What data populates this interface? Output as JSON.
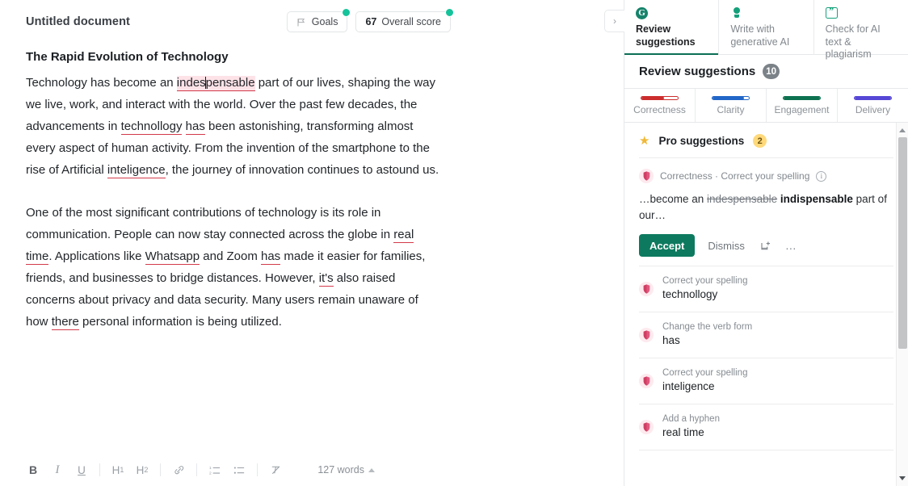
{
  "document": {
    "title": "Untitled document",
    "goals_label": "Goals",
    "score_value": "67",
    "score_label": "Overall score",
    "heading": "The Rapid Evolution of Technology",
    "paragraph1": {
      "seg1": "Technology has become an ",
      "error1": "indes",
      "error1b": "pensable",
      "seg2": " part of our lives, shaping the way we live, work, and interact with the world. Over the past few decades, the advancements in ",
      "error2": "technollogy",
      "seg3": " ",
      "error3": "has",
      "seg4": " been astonishing, transforming almost every aspect of human activity. From the invention of the smartphone to the rise of Artificial ",
      "error4": "inteligence",
      "seg5": ", the journey of innovation continues to astound us."
    },
    "paragraph2": {
      "seg1": "One of the most significant contributions of technology is its role in communication. People can now stay connected across the globe in ",
      "error1": "real time",
      "seg2": ". Applications like ",
      "error2": "Whatsapp",
      "seg3": " and Zoom ",
      "error3": "has",
      "seg4": " made it easier for families, friends, and businesses to bridge distances. However, ",
      "error4": "it's",
      "seg5": " also raised concerns about privacy and data security. Many users remain unaware of how ",
      "error5": "there",
      "seg6": " personal information is being utilized."
    },
    "toolbar": {
      "bold": "B",
      "italic": "I",
      "underline": "U",
      "h1": "H",
      "h1_sub": "1",
      "h2": "H",
      "h2_sub": "2",
      "link_icon": "link-icon",
      "ordered_list_icon": "ordered-list-icon",
      "bullet_list_icon": "bullet-list-icon",
      "clear_format_icon": "clear-formatting-icon",
      "word_count": "127 words"
    }
  },
  "sidebar": {
    "collapse_icon": "›",
    "tabs": [
      {
        "label": "Review suggestions",
        "icon": "grammarly-g-logo",
        "active": true
      },
      {
        "label": "Write with generative AI",
        "icon": "lightbulb-icon",
        "active": false
      },
      {
        "label": "Check for AI text & plagiarism",
        "icon": "quote-icon",
        "active": false
      }
    ],
    "review": {
      "title": "Review suggestions",
      "count": "10"
    },
    "categories": [
      {
        "label": "Correctness",
        "color": "#cc2d2d",
        "fill": 62
      },
      {
        "label": "Clarity",
        "color": "#2166c8",
        "fill": 86
      },
      {
        "label": "Engagement",
        "color": "#0d7150",
        "fill": 100
      },
      {
        "label": "Delivery",
        "color": "#5647d6",
        "fill": 100
      }
    ],
    "pro": {
      "title": "Pro suggestions",
      "count": "2"
    },
    "open_card": {
      "meta": "Correctness · Correct your spelling",
      "info_glyph": "i",
      "text_before": "…become an ",
      "text_strike": "indespensable",
      "text_fix": "indispensable",
      "text_after": " part of our…",
      "accept_label": "Accept",
      "dismiss_label": "Dismiss",
      "add_dictionary_icon": "add-to-dictionary-icon",
      "more_icon": "…"
    },
    "suggestions": [
      {
        "kind": "Correct your spelling",
        "target": "technollogy"
      },
      {
        "kind": "Change the verb form",
        "target": "has"
      },
      {
        "kind": "Correct your spelling",
        "target": "inteligence"
      },
      {
        "kind": "Add a hyphen",
        "target": "real time"
      }
    ],
    "scrollbar": {
      "up": "scroll-up-arrow",
      "down": "scroll-down-arrow"
    }
  },
  "colors": {
    "accent_green": "#0d7a5f",
    "dot_teal": "#15c39a",
    "error_red": "#d33a4b",
    "highlight_pink": "#fde3e8",
    "star_gold": "#f0b836"
  }
}
